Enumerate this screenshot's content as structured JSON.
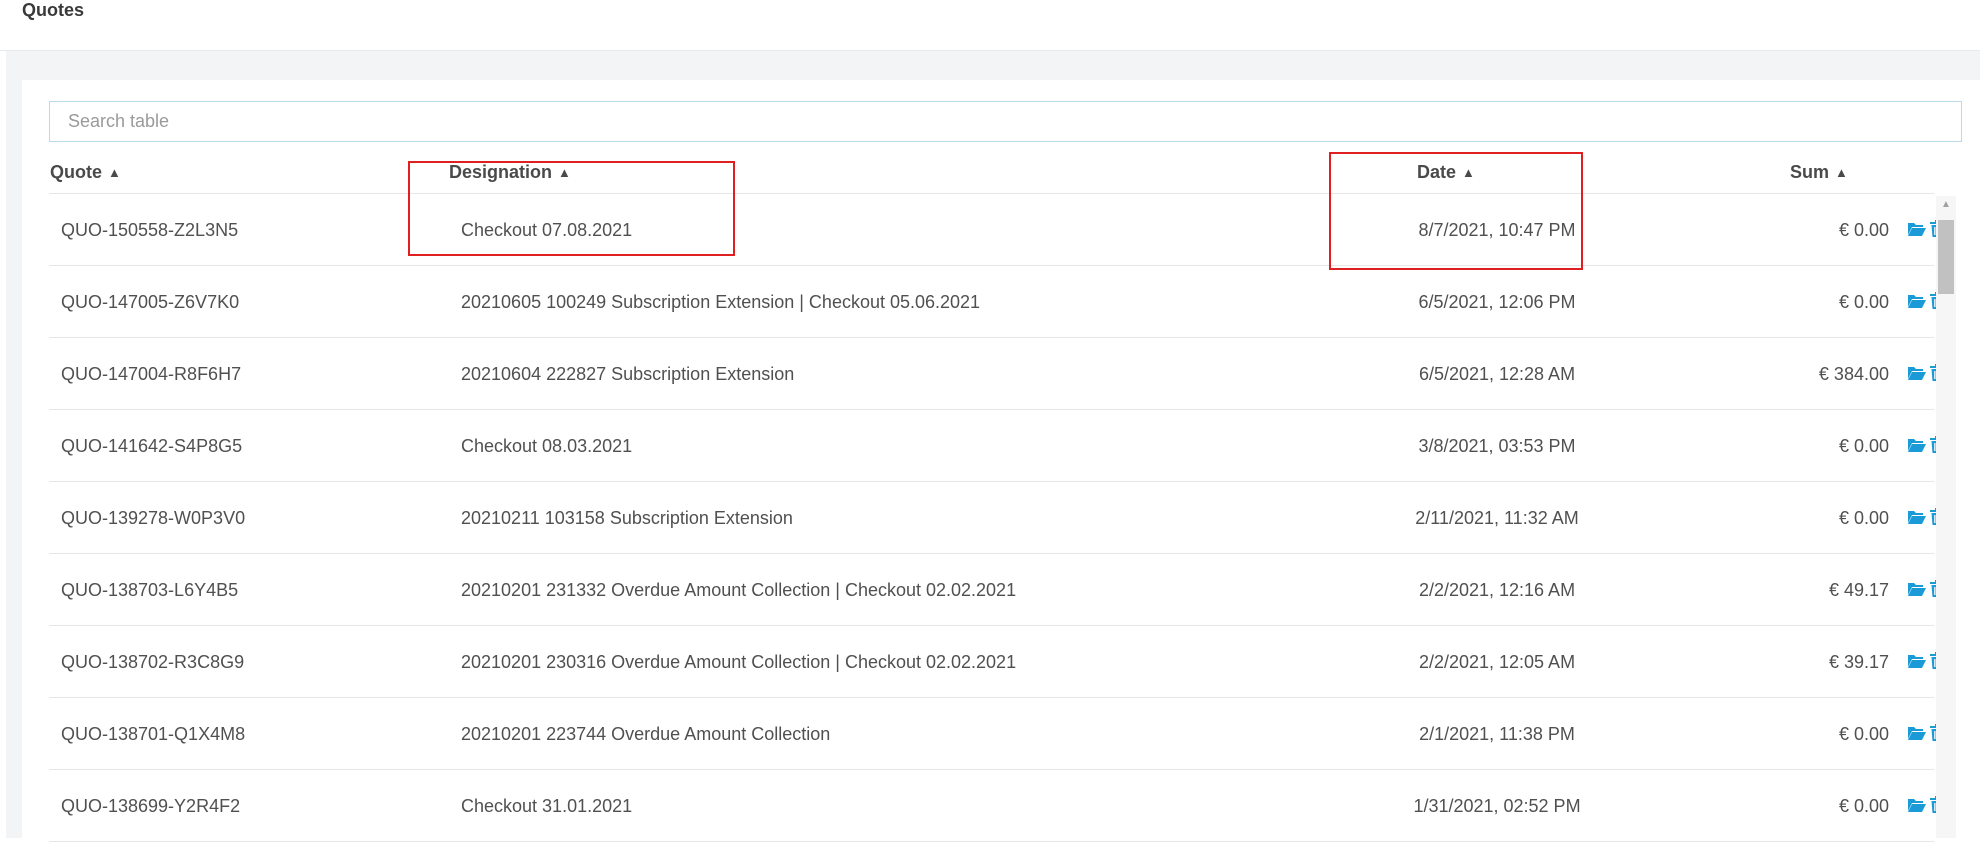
{
  "page": {
    "title": "Quotes"
  },
  "search": {
    "placeholder": "Search table"
  },
  "columns": {
    "quote": "Quote",
    "designation": "Designation",
    "date": "Date",
    "sum": "Sum"
  },
  "icons": {
    "sort": "sort-icon",
    "open": "folder-open-icon",
    "delete": "trash-icon",
    "accent": "#1a9bd7"
  },
  "rows": [
    {
      "quote": "QUO-150558-Z2L3N5",
      "designation": "Checkout 07.08.2021",
      "date": "8/7/2021, 10:47 PM",
      "sum": "€ 0.00"
    },
    {
      "quote": "QUO-147005-Z6V7K0",
      "designation": "20210605 100249 Subscription Extension | Checkout 05.06.2021",
      "date": "6/5/2021, 12:06 PM",
      "sum": "€ 0.00"
    },
    {
      "quote": "QUO-147004-R8F6H7",
      "designation": "20210604 222827 Subscription Extension",
      "date": "6/5/2021, 12:28 AM",
      "sum": "€ 384.00"
    },
    {
      "quote": "QUO-141642-S4P8G5",
      "designation": "Checkout 08.03.2021",
      "date": "3/8/2021, 03:53 PM",
      "sum": "€ 0.00"
    },
    {
      "quote": "QUO-139278-W0P3V0",
      "designation": "20210211 103158 Subscription Extension",
      "date": "2/11/2021, 11:32 AM",
      "sum": "€ 0.00"
    },
    {
      "quote": "QUO-138703-L6Y4B5",
      "designation": "20210201 231332 Overdue Amount Collection | Checkout 02.02.2021",
      "date": "2/2/2021, 12:16 AM",
      "sum": "€ 49.17"
    },
    {
      "quote": "QUO-138702-R3C8G9",
      "designation": "20210201 230316 Overdue Amount Collection | Checkout 02.02.2021",
      "date": "2/2/2021, 12:05 AM",
      "sum": "€ 39.17"
    },
    {
      "quote": "QUO-138701-Q1X4M8",
      "designation": "20210201 223744 Overdue Amount Collection",
      "date": "2/1/2021, 11:38 PM",
      "sum": "€ 0.00"
    },
    {
      "quote": "QUO-138699-Y2R4F2",
      "designation": "Checkout 31.01.2021",
      "date": "1/31/2021, 02:52 PM",
      "sum": "€ 0.00"
    }
  ]
}
